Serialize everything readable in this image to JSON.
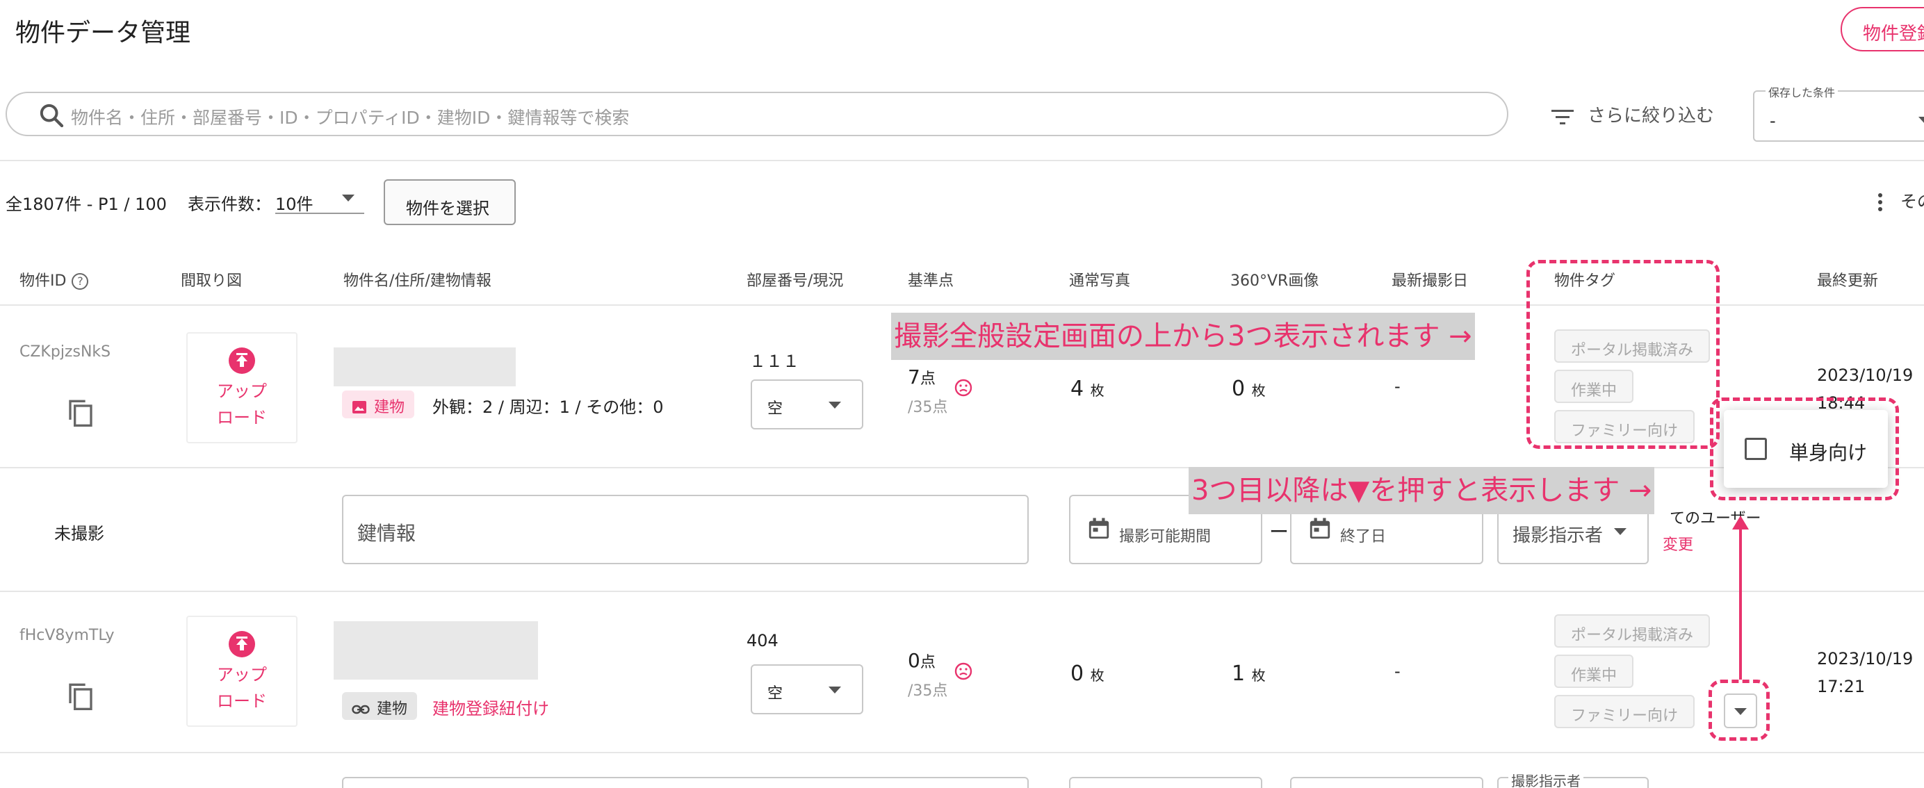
{
  "header": {
    "title": "物件データ管理",
    "register_label": "物件登録"
  },
  "search": {
    "placeholder": "物件名・住所・部屋番号・ID・プロパティID・建物ID・鍵情報等で検索"
  },
  "filter": {
    "more_label": "さらに絞り込む",
    "saved_label": "保存した条件",
    "saved_value": "-"
  },
  "toolbar": {
    "count_text": "全1807件 - P1 / 100",
    "per_page_label": "表示件数：",
    "per_page_value": "10件",
    "select_label": "物件を選択",
    "more_label": "その"
  },
  "columns": {
    "id": "物件ID",
    "floorplan": "間取り図",
    "name": "物件名/住所/建物情報",
    "room": "部屋番号/現況",
    "score": "基準点",
    "photos": "通常写真",
    "vr": "360°VR画像",
    "latest_shoot": "最新撮影日",
    "tags": "物件タグ",
    "updated": "最終更新"
  },
  "upload_label_1": "アップ",
  "upload_label_2": "ロード",
  "rows": [
    {
      "id": "CZKpjzsNkS",
      "building_chip": "建物",
      "photo_breakdown": "外観：2 / 周辺：1 / その他：0",
      "room_no": "１１１",
      "status": "空",
      "score": "7",
      "score_unit": "点",
      "score_max": "/35点",
      "photos": "4",
      "vr": "0",
      "unit": "枚",
      "latest_shoot": "-",
      "tags": [
        "ポータル掲載済み",
        "作業中",
        "ファミリー向け"
      ],
      "updated_date": "2023/10/19",
      "updated_time": "18:44"
    },
    {
      "id": "fHcV8ymTLy",
      "building_chip": "建物",
      "link_text": "建物登録紐付け",
      "room_no": "404",
      "status": "空",
      "score": "0",
      "score_unit": "点",
      "score_max": "/35点",
      "photos": "0",
      "vr": "1",
      "unit": "枚",
      "latest_shoot": "-",
      "tags": [
        "ポータル掲載済み",
        "作業中",
        "ファミリー向け"
      ],
      "updated_date": "2023/10/19",
      "updated_time": "17:21"
    }
  ],
  "subrow": {
    "shoot_status": "未撮影",
    "key_info_placeholder": "鍵情報",
    "period_placeholder": "撮影可能期間",
    "dash": "ー",
    "end_placeholder": "終了日",
    "instructor_label": "撮影指示者",
    "users_text": "てのユーザー",
    "change_label": "変更"
  },
  "next_row": {
    "instructor_label": "撮影指示者"
  },
  "dropdown": {
    "option": "単身向け"
  },
  "annotations": {
    "top": "撮影全般設定画面の上から3つ表示されます →",
    "bottom": "3つ目以降は▼を押すと表示します →"
  },
  "colors": {
    "accent": "#e8336d",
    "annotation_bg": "#d2d2d2"
  }
}
